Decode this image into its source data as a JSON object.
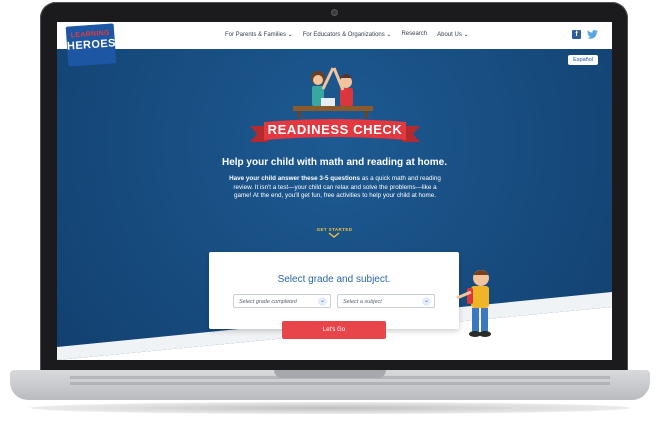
{
  "brand": {
    "line1": "LEARNING",
    "line2": "HEROES"
  },
  "nav": {
    "items": [
      "For Parents & Families ⌄",
      "For Educators & Organizations ⌄",
      "Research",
      "About Us ⌄"
    ]
  },
  "social": {
    "facebook": "f",
    "twitter": "🐦"
  },
  "language_button": "Español",
  "hero": {
    "banner": "READINESS CHECK",
    "headline": "Help your child with math and reading at home.",
    "intro_bold": "Have your child answer these 3-5 questions",
    "intro_rest": " as a quick math and reading review. It isn't a test—your child can relax and solve the problems—like a game! At the end, you'll get fun, free activities to help your child at home.",
    "cta": "GET STARTED"
  },
  "form": {
    "title": "Select grade and subject.",
    "grade_placeholder": "Select grade completed",
    "subject_placeholder": "Select a subject",
    "submit": "Let's Go"
  },
  "colors": {
    "hero_blue": "#15497d",
    "accent_red": "#e8454b",
    "link_blue": "#2a66a8",
    "cta_yellow": "#f2c23a"
  }
}
